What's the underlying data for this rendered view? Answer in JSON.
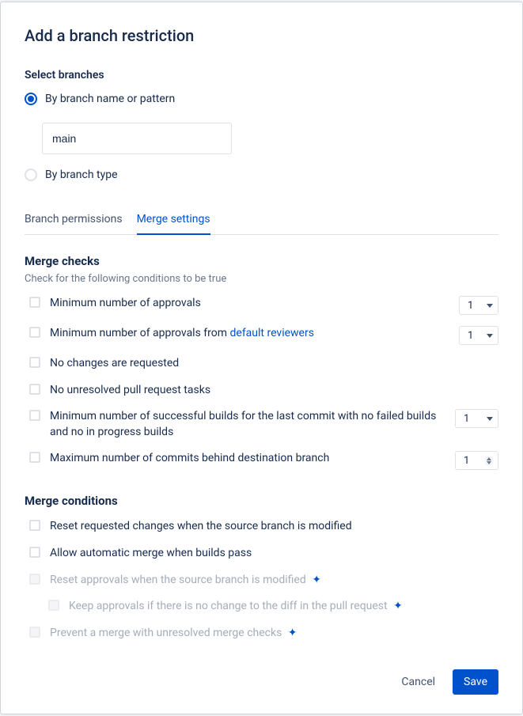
{
  "title": "Add a branch restriction",
  "select_branches_label": "Select branches",
  "radio_pattern_label": "By branch name or pattern",
  "radio_type_label": "By branch type",
  "branch_input_value": "main",
  "tabs": {
    "permissions": "Branch permissions",
    "merge": "Merge settings"
  },
  "merge_checks": {
    "heading": "Merge checks",
    "hint": "Check for the following conditions to be true",
    "min_approvals_label": "Minimum number of approvals",
    "min_approvals_value": "1",
    "min_default_reviewers_prefix": "Minimum number of approvals from ",
    "min_default_reviewers_link": "default reviewers",
    "min_default_reviewers_value": "1",
    "no_changes_label": "No changes are requested",
    "no_tasks_label": "No unresolved pull request tasks",
    "min_builds_label": "Minimum number of successful builds for the last commit with no failed builds and no in progress builds",
    "min_builds_value": "1",
    "max_commits_label": "Maximum number of commits behind destination branch",
    "max_commits_value": "1"
  },
  "merge_conditions": {
    "heading": "Merge conditions",
    "reset_changes_label": "Reset requested changes when the source branch is modified",
    "auto_merge_label": "Allow automatic merge when builds pass",
    "reset_approvals_label": "Reset approvals when the source branch is modified",
    "keep_approvals_label": "Keep approvals if there is no change to the diff in the pull request",
    "prevent_merge_label": "Prevent a merge with unresolved merge checks"
  },
  "footer": {
    "cancel": "Cancel",
    "save": "Save"
  }
}
